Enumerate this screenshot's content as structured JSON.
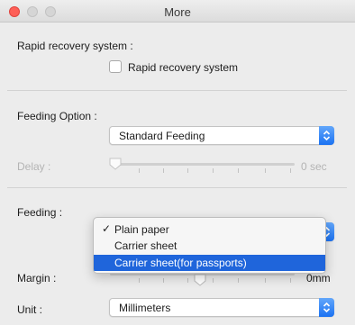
{
  "window": {
    "title": "More"
  },
  "rapid_recovery": {
    "section_label": "Rapid recovery system :",
    "checkbox_label": "Rapid recovery system",
    "checked": false
  },
  "feeding_option": {
    "label": "Feeding Option :",
    "selected": "Standard Feeding"
  },
  "delay": {
    "label": "Delay :",
    "value_text": "0 sec",
    "enabled": false
  },
  "feeding": {
    "label": "Feeding :",
    "menu_items": [
      {
        "label": "Plain paper",
        "checked": true,
        "highlighted": false
      },
      {
        "label": "Carrier sheet",
        "checked": false,
        "highlighted": false
      },
      {
        "label": "Carrier sheet(for passports)",
        "checked": false,
        "highlighted": true
      }
    ]
  },
  "margin": {
    "label": "Margin :",
    "value_text": "0mm"
  },
  "unit": {
    "label": "Unit :",
    "selected": "Millimeters"
  },
  "colors": {
    "accent": "#1f65db",
    "popup_arrow": "#1b72f2",
    "close_light": "#fe5f57"
  }
}
